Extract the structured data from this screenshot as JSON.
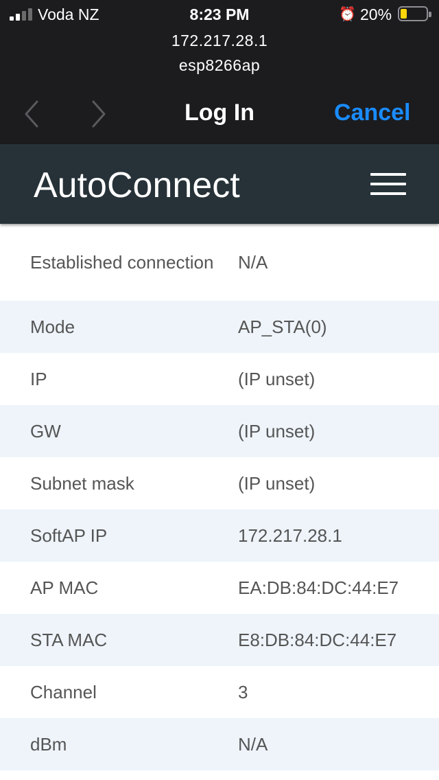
{
  "status_bar": {
    "carrier": "Voda NZ",
    "time": "8:23 PM",
    "battery_percent": "20%",
    "battery_level": 0.2,
    "signal_bars_active": 2,
    "signal_bars_total": 4,
    "alarm_icon": "alarm-clock-icon"
  },
  "browser": {
    "url": "172.217.28.1",
    "ssid": "esp8266ap",
    "title": "Log In",
    "cancel_label": "Cancel",
    "accent_color": "#1a8cff"
  },
  "app": {
    "brand": "AutoConnect",
    "header_color": "#263238",
    "menu_icon": "hamburger-menu-icon"
  },
  "rows": [
    {
      "label": "Established connection",
      "value": "N/A"
    },
    {
      "label": "Mode",
      "value": "AP_STA(0)"
    },
    {
      "label": "IP",
      "value": "(IP unset)"
    },
    {
      "label": "GW",
      "value": "(IP unset)"
    },
    {
      "label": "Subnet mask",
      "value": "(IP unset)"
    },
    {
      "label": "SoftAP IP",
      "value": "172.217.28.1"
    },
    {
      "label": "AP MAC",
      "value": "EA:DB:84:DC:44:E7"
    },
    {
      "label": "STA MAC",
      "value": "E8:DB:84:DC:44:E7"
    },
    {
      "label": "Channel",
      "value": "3"
    },
    {
      "label": "dBm",
      "value": "N/A"
    }
  ]
}
